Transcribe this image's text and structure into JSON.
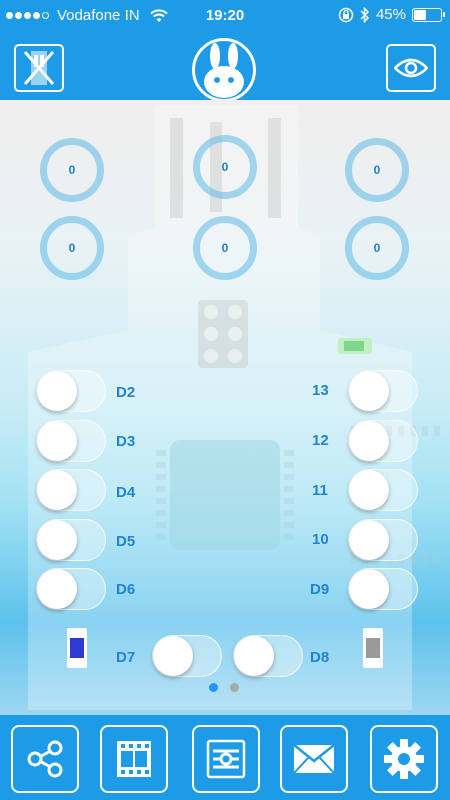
{
  "status": {
    "carrier": "Vodafone IN",
    "time": "19:20",
    "battery_text": "45%",
    "battery_level": 0.45,
    "signal_bars": 4,
    "signal_max": 5
  },
  "header": {
    "left_icon": "disconnected-device-icon",
    "logo_icon": "bunny-logo-icon",
    "right_icon": "eye-icon"
  },
  "knobs": [
    "0",
    "0",
    "0",
    "0",
    "0",
    "0"
  ],
  "pins_left": [
    "D2",
    "D3",
    "D4",
    "D5",
    "D6"
  ],
  "pins_right": [
    "13",
    "12",
    "11",
    "10",
    "D9"
  ],
  "pins_bottom": [
    "D7",
    "D8"
  ],
  "pager": {
    "pages": 2,
    "current": 1
  },
  "toolbar": {
    "icons": [
      "share-icon",
      "film-icon",
      "settings-sliders-icon",
      "mail-icon",
      "gear-icon"
    ]
  },
  "colors": {
    "primary": "#1d9be6",
    "pin_label": "#1f84d6",
    "knob_ring": "#5eb9e6"
  }
}
